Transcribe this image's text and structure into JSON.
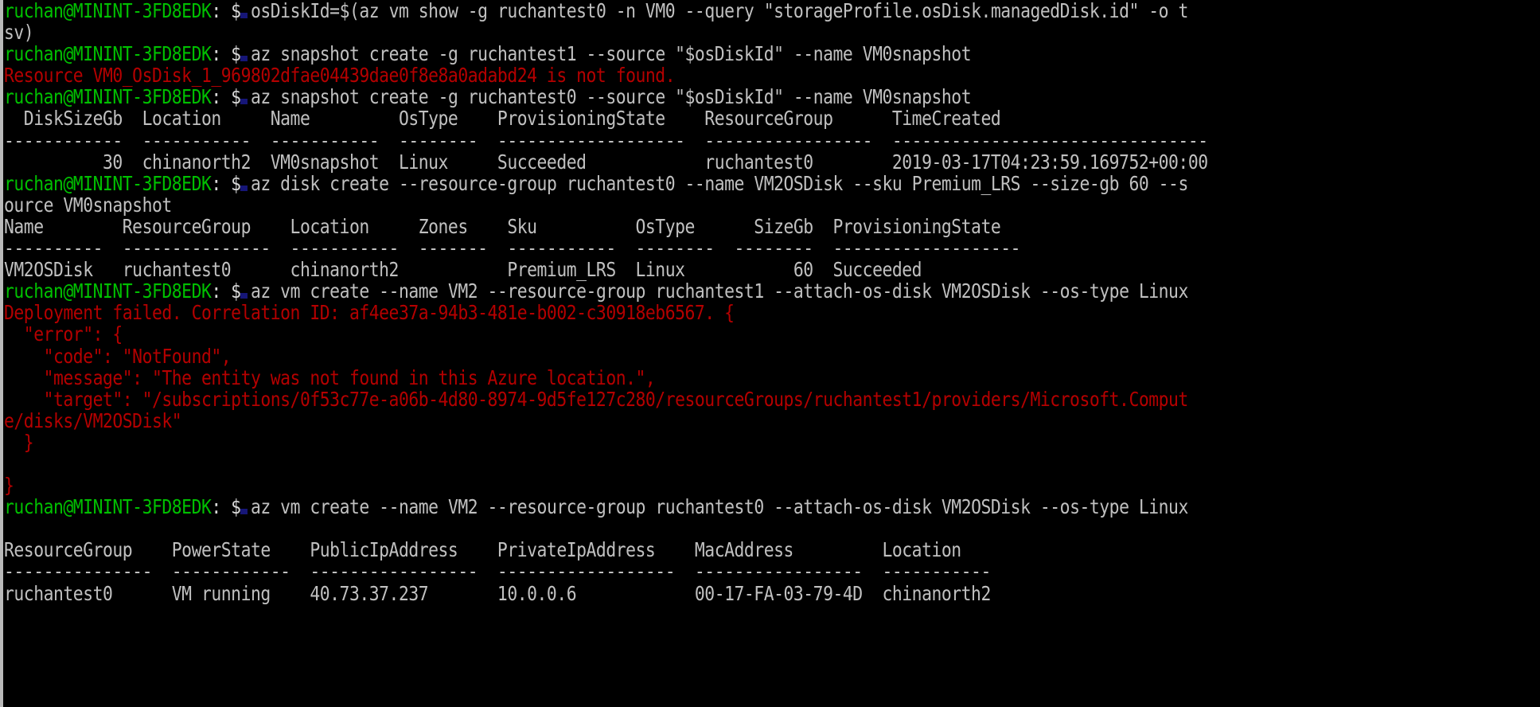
{
  "terminal": {
    "title": "Azure CLI terminal session",
    "prompt_user_host": "ruchan@MININT-3FD8EDK",
    "prompt_separator": ": ",
    "prompt_symbol": "$ ",
    "colors": {
      "background": "#000000",
      "prompt_green": "#00c000",
      "text_gray": "#c0c0c0",
      "error_red": "#b40000",
      "scrollbar_gray": "#b9b9b9"
    },
    "scrollbar": {
      "name": "vertical-scrollbar",
      "position": "left"
    }
  },
  "lines": [
    {
      "type": "prompt",
      "command": "osDiskId=$(az vm show -g ruchantest0 -n VM0 --query \"storageProfile.osDisk.managedDisk.id\" -o t"
    },
    {
      "type": "output",
      "text": "sv)"
    },
    {
      "type": "prompt",
      "command": "az snapshot create -g ruchantest1 --source \"$osDiskId\" --name VM0snapshot"
    },
    {
      "type": "error",
      "text": "Resource VM0_OsDisk_1_969802dfae04439dae0f8e8a0adabd24 is not found."
    },
    {
      "type": "prompt",
      "command": "az snapshot create -g ruchantest0 --source \"$osDiskId\" --name VM0snapshot"
    },
    {
      "type": "output",
      "text": "  DiskSizeGb  Location     Name         OsType    ProvisioningState    ResourceGroup      TimeCreated"
    },
    {
      "type": "output",
      "text": "------------  -----------  -----------  --------  -------------------  -----------------  --------------------------------"
    },
    {
      "type": "output",
      "text": "          30  chinanorth2  VM0snapshot  Linux     Succeeded            ruchantest0        2019-03-17T04:23:59.169752+00:00"
    },
    {
      "type": "prompt",
      "command": "az disk create --resource-group ruchantest0 --name VM2OSDisk --sku Premium_LRS --size-gb 60 --s"
    },
    {
      "type": "output",
      "text": "ource VM0snapshot"
    },
    {
      "type": "output",
      "text": "Name        ResourceGroup    Location     Zones    Sku          OsType      SizeGb  ProvisioningState"
    },
    {
      "type": "output",
      "text": "----------  ---------------  -----------  -------  -----------  --------  --------  -------------------"
    },
    {
      "type": "output",
      "text": "VM2OSDisk   ruchantest0      chinanorth2           Premium_LRS  Linux           60  Succeeded"
    },
    {
      "type": "prompt",
      "command": "az vm create --name VM2 --resource-group ruchantest1 --attach-os-disk VM2OSDisk --os-type Linux"
    },
    {
      "type": "error",
      "text": "Deployment failed. Correlation ID: af4ee37a-94b3-481e-b002-c30918eb6567. {"
    },
    {
      "type": "error",
      "text": "  \"error\": {"
    },
    {
      "type": "error",
      "text": "    \"code\": \"NotFound\","
    },
    {
      "type": "error",
      "text": "    \"message\": \"The entity was not found in this Azure location.\","
    },
    {
      "type": "error",
      "text": "    \"target\": \"/subscriptions/0f53c77e-a06b-4d80-8974-9d5fe127c280/resourceGroups/ruchantest1/providers/Microsoft.Comput"
    },
    {
      "type": "error",
      "text": "e/disks/VM2OSDisk\""
    },
    {
      "type": "error",
      "text": "  }"
    },
    {
      "type": "error",
      "text": ""
    },
    {
      "type": "error",
      "text": "}"
    },
    {
      "type": "prompt",
      "command": "az vm create --name VM2 --resource-group ruchantest0 --attach-os-disk VM2OSDisk --os-type Linux"
    },
    {
      "type": "output",
      "text": ""
    },
    {
      "type": "output",
      "text": "ResourceGroup    PowerState    PublicIpAddress    PrivateIpAddress    MacAddress         Location"
    },
    {
      "type": "output",
      "text": "---------------  ------------  -----------------  ------------------  -----------------  -----------"
    },
    {
      "type": "output",
      "text": "ruchantest0      VM running    40.73.37.237       10.0.0.6            00-17-FA-03-79-4D  chinanorth2"
    }
  ]
}
